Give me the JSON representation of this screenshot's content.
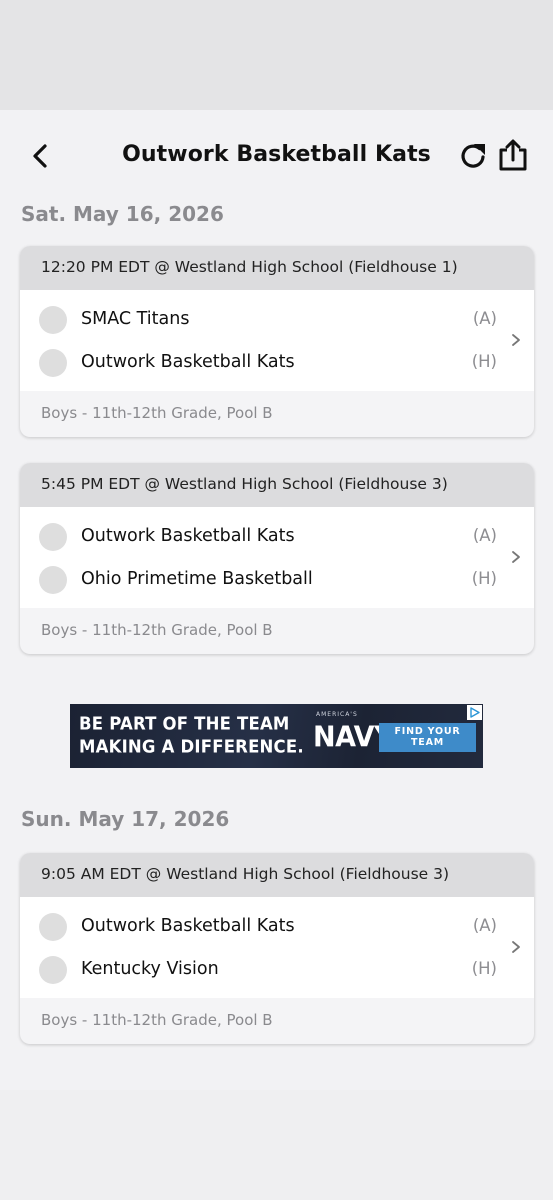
{
  "header": {
    "title": "Outwork Basketball Kats",
    "back_icon": "chevron-left-icon",
    "refresh_icon": "refresh-icon",
    "share_icon": "share-icon"
  },
  "days": [
    {
      "date": "Sat. May 16, 2026",
      "games": [
        {
          "header": "12:20 PM EDT @ Westland High School (Fieldhouse 1)",
          "team1": {
            "name": "SMAC Titans",
            "ha": "(A)"
          },
          "team2": {
            "name": "Outwork Basketball Kats",
            "ha": "(H)"
          },
          "footer": "Boys - 11th-12th Grade, Pool B"
        },
        {
          "header": "5:45 PM EDT @ Westland High School (Fieldhouse 3)",
          "team1": {
            "name": "Outwork Basketball Kats",
            "ha": "(A)"
          },
          "team2": {
            "name": "Ohio Primetime Basketball",
            "ha": "(H)"
          },
          "footer": "Boys - 11th-12th Grade, Pool B"
        }
      ]
    },
    {
      "date": "Sun. May 17, 2026",
      "games": [
        {
          "header": "9:05 AM EDT @ Westland High School (Fieldhouse 3)",
          "team1": {
            "name": "Outwork Basketball Kats",
            "ha": "(A)"
          },
          "team2": {
            "name": "Kentucky Vision",
            "ha": "(H)"
          },
          "footer": "Boys - 11th-12th Grade, Pool B"
        }
      ]
    }
  ],
  "ad": {
    "line1": "BE PART OF THE TEAM",
    "line2": "MAKING A DIFFERENCE.",
    "brand_sub": "AMERICA'S",
    "brand": "NAVY",
    "cta": "FIND YOUR TEAM"
  },
  "colors": {
    "accent_ad_button": "#3e8bc9",
    "card_header": "#dcdcde",
    "date_text": "#8a8a8e"
  }
}
